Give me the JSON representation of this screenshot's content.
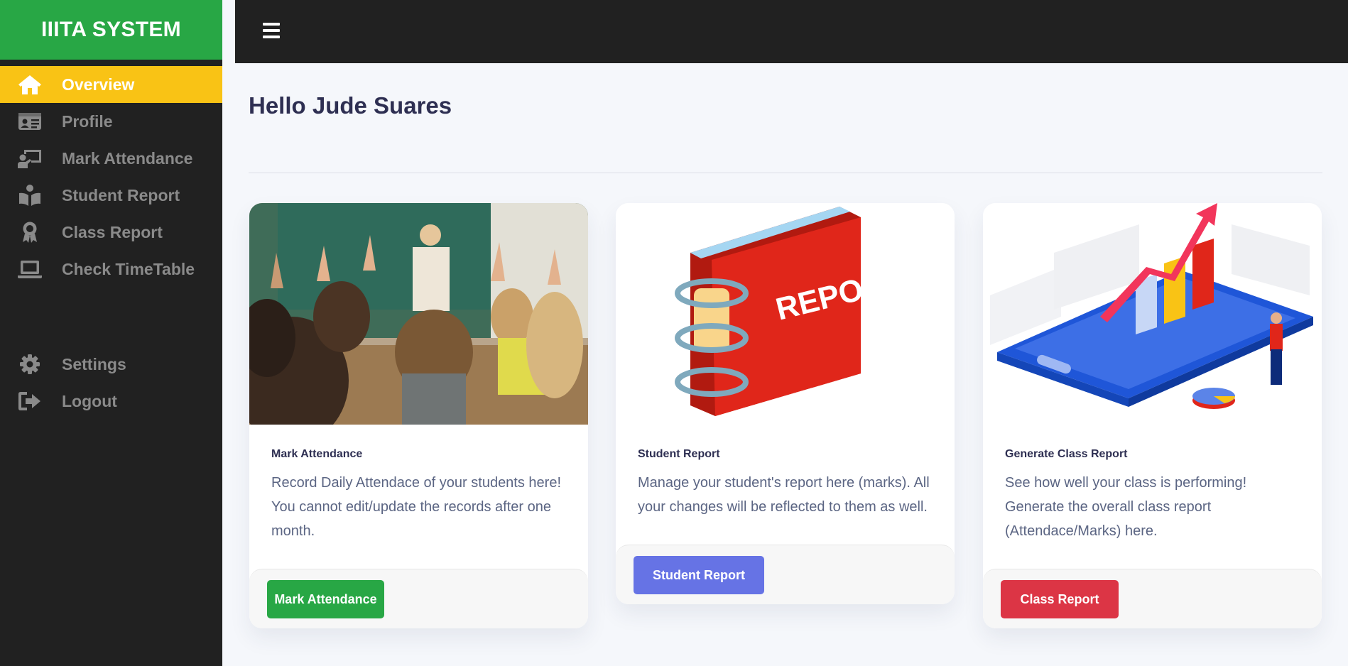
{
  "sidebar": {
    "brand": "IIITA SYSTEM",
    "items": [
      {
        "label": "Overview",
        "icon": "home-icon",
        "active": true
      },
      {
        "label": "Profile",
        "icon": "id-card-icon"
      },
      {
        "label": "Mark Attendance",
        "icon": "chalkboard-teacher-icon"
      },
      {
        "label": "Student Report",
        "icon": "book-reader-icon"
      },
      {
        "label": "Class Report",
        "icon": "award-icon"
      },
      {
        "label": "Check TimeTable",
        "icon": "laptop-icon"
      }
    ],
    "bottom_items": [
      {
        "label": "Settings",
        "icon": "gear-icon"
      },
      {
        "label": "Logout",
        "icon": "sign-out-icon"
      }
    ]
  },
  "header": {
    "menu_icon": "hamburger-icon"
  },
  "main": {
    "greeting": "Hello Jude Suares",
    "cards": [
      {
        "title": "Mark Attendance",
        "text": "Record Daily Attendace of your students here! You cannot edit/update the records after one month.",
        "button": "Mark Attendance",
        "button_color": "#28a745",
        "image": "classroom-photo"
      },
      {
        "title": "Student Report",
        "text": "Manage your student's report here (marks). All your changes will be reflected to them as well.",
        "button": "Student Report",
        "button_color": "#6673e5",
        "image": "report-book-illustration"
      },
      {
        "title": "Generate Class Report",
        "text": "See how well your class is performing! Generate the overall class report (Attendace/Marks) here.",
        "button": "Class Report",
        "button_color": "#dc3545",
        "image": "analytics-illustration"
      }
    ]
  },
  "colors": {
    "accent_green": "#28a745",
    "active_yellow": "#f9c315",
    "dark": "#212121"
  }
}
